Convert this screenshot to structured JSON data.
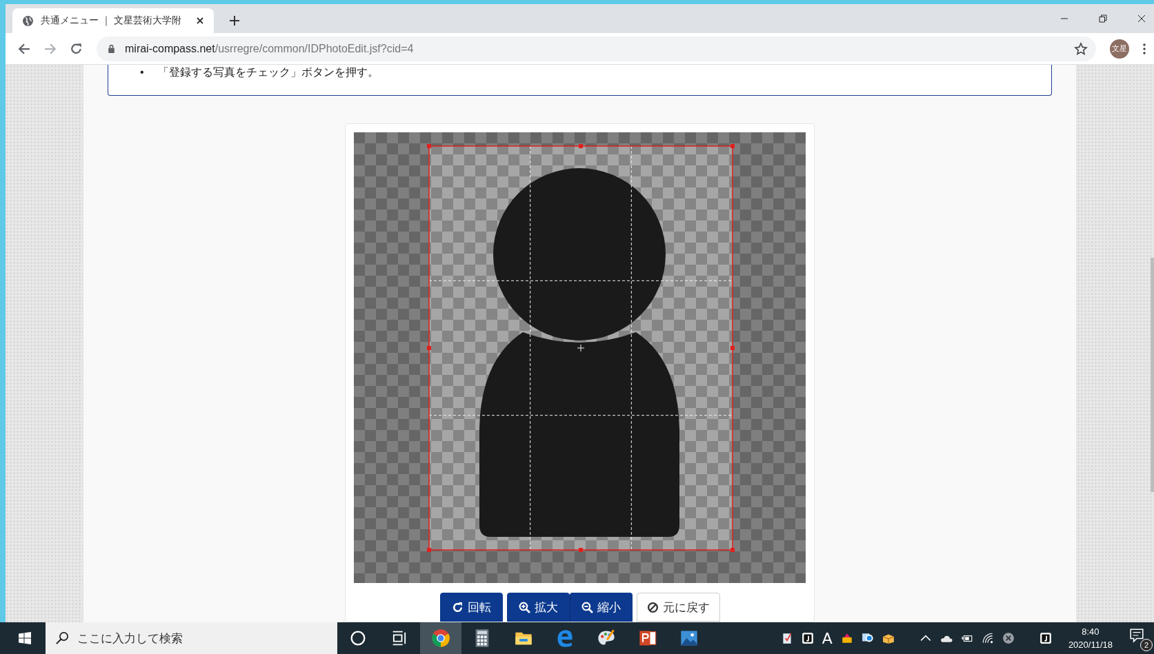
{
  "browser": {
    "tab": {
      "title": "共通メニュー ｜ 文星芸術大学附",
      "selected": true
    },
    "url_host": "mirai-compass.net",
    "url_path": "/usrregre/common/IDPhotoEdit.jsf?cid=4",
    "profile": "文星"
  },
  "notice": {
    "items": [
      {
        "marker": "•",
        "text": "「登録する写真をチェック」ボタンを押す。"
      }
    ]
  },
  "editor": {
    "button_groups": [
      {
        "buttons": [
          {
            "kind": "rotate",
            "label": "回転"
          }
        ]
      },
      {
        "buttons": [
          {
            "kind": "zoom_in",
            "label": "拡大"
          },
          {
            "kind": "zoom_out",
            "label": "縮小"
          }
        ]
      },
      {
        "buttons": [
          {
            "kind": "reset",
            "label": "元に戻す"
          }
        ]
      }
    ]
  },
  "taskbar": {
    "search": {
      "placeholder": "ここに入力して検索"
    },
    "apps": [
      {
        "kind": "cortana",
        "selected": false
      },
      {
        "kind": "taskview",
        "selected": false
      },
      {
        "kind": "chrome",
        "selected": true
      },
      {
        "kind": "calculator",
        "selected": false
      },
      {
        "kind": "folder",
        "selected": false
      },
      {
        "kind": "edge",
        "selected": false
      },
      {
        "kind": "paint",
        "selected": false
      },
      {
        "kind": "powerpoint",
        "selected": false
      },
      {
        "kind": "photos",
        "selected": false
      }
    ],
    "ime": "A",
    "time": "8:40",
    "date": "2020/11/18",
    "notifications": "2"
  }
}
